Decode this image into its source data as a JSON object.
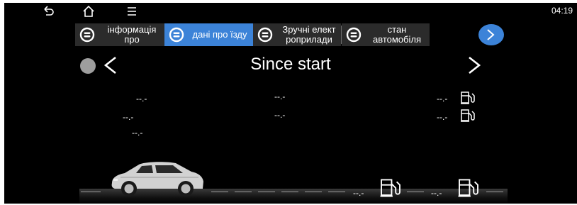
{
  "status_bar": {
    "clock": "04:19",
    "back_icon": "back-arrow-icon",
    "home_icon": "home-icon",
    "menu_icon": "menu-icon"
  },
  "tabs": [
    {
      "label": "інформація\nпро",
      "active": false,
      "icon": "odometer-icon"
    },
    {
      "label": "дані про їзду",
      "active": true,
      "icon": "odometer-icon"
    },
    {
      "label": "Зручні елект\nроприлади",
      "active": false,
      "icon": "odometer-icon"
    },
    {
      "label": "стан\nавтомобіля",
      "active": false,
      "icon": "odometer-icon"
    }
  ],
  "colors": {
    "accent": "#3c83d8",
    "active_tab": "#3c83d8",
    "tab_bg": "#2b2b2b",
    "background": "#000000"
  },
  "header": {
    "title": "Since start"
  },
  "readouts": {
    "left_1": "--.-",
    "left_2": "--.-",
    "left_3": "--.-",
    "middle_1": "--.-",
    "middle_2": "--.-",
    "right_1": "--.-",
    "right_2": "--.-",
    "bottom_1": "--.-",
    "bottom_2": "--.-"
  }
}
